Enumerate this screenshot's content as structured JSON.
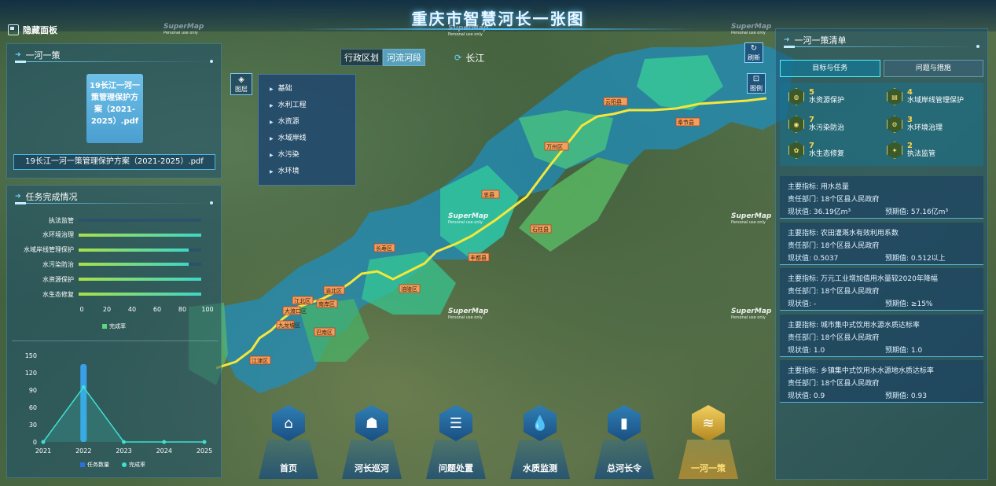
{
  "header": {
    "title": "重庆市智慧河长一张图",
    "hide_panel": "隐藏面板"
  },
  "watermark": {
    "brand": "SuperMap",
    "sub": "Personal use only"
  },
  "left_top": {
    "title": "一河一策",
    "doc_icon_text": "19长江一河一策管理保护方案（2021-2025）.pdf",
    "doc_name": "19长江一河一策管理保护方案（2021-2025）.pdf"
  },
  "task": {
    "title": "任务完成情况",
    "bars": [
      {
        "label": "执法监管",
        "value": 0
      },
      {
        "label": "水环境治理",
        "value": 100
      },
      {
        "label": "水域岸线管理保护",
        "value": 90
      },
      {
        "label": "水污染防治",
        "value": 90
      },
      {
        "label": "水资源保护",
        "value": 100
      },
      {
        "label": "水生态修复",
        "value": 100
      }
    ],
    "bar_ticks": [
      "0",
      "20",
      "40",
      "60",
      "80",
      "100"
    ],
    "bar_legend": "完成率",
    "line_chart": {
      "years": [
        "2021",
        "2022",
        "2023",
        "2024",
        "2025"
      ],
      "y_ticks": [
        "150",
        "120",
        "90",
        "60",
        "30",
        "0"
      ],
      "ymax": 150,
      "task_count": [
        0,
        135,
        0,
        0,
        0
      ],
      "completion": [
        0,
        95,
        0,
        0,
        0
      ],
      "legend_count": "任务数量",
      "legend_rate": "完成率"
    }
  },
  "map": {
    "tabs": [
      "行政区划",
      "河流河段"
    ],
    "river": "长江",
    "layer_btn": "图层",
    "layers": [
      "基础",
      "水利工程",
      "水资源",
      "水域岸线",
      "水污染",
      "水环境"
    ],
    "refresh": "刷新",
    "legend": "图例",
    "regions": [
      "云阳县",
      "奉节县",
      "万州区",
      "忠县",
      "石柱县",
      "长寿区",
      "丰都县",
      "涪陵区",
      "渝北区",
      "江北区",
      "南岸区",
      "巴南区",
      "江津区",
      "大渡口区",
      "九龙坡区"
    ]
  },
  "right": {
    "title": "一河一策清单",
    "tabs": [
      "目标与任务",
      "问题与措施"
    ],
    "goals": [
      {
        "num": "5",
        "name": "水资源保护",
        "icon": "shield-icon"
      },
      {
        "num": "4",
        "name": "水域岸线管理保护",
        "icon": "bank-icon"
      },
      {
        "num": "7",
        "name": "水污染防治",
        "icon": "drop-icon"
      },
      {
        "num": "3",
        "name": "水环境治理",
        "icon": "gear-icon"
      },
      {
        "num": "7",
        "name": "水生态修复",
        "icon": "leaf-icon"
      },
      {
        "num": "2",
        "name": "执法监管",
        "icon": "badge-icon"
      }
    ],
    "metrics": [
      {
        "label": "主要指标:",
        "indicator": "用水总量",
        "dept_label": "责任部门:",
        "dept": "18个区县人民政府",
        "cur_label": "现状值:",
        "cur": "36.19亿m³",
        "exp_label": "预期值:",
        "exp": "57.16亿m³"
      },
      {
        "label": "主要指标:",
        "indicator": "农田灌溉水有效利用系数",
        "dept_label": "责任部门:",
        "dept": "18个区县人民政府",
        "cur_label": "现状值:",
        "cur": "0.5037",
        "exp_label": "预期值:",
        "exp": "0.512以上"
      },
      {
        "label": "主要指标:",
        "indicator": "万元工业增加值用水量较2020年降幅",
        "dept_label": "责任部门:",
        "dept": "18个区县人民政府",
        "cur_label": "现状值:",
        "cur": "-",
        "exp_label": "预期值:",
        "exp": "≥15%"
      },
      {
        "label": "主要指标:",
        "indicator": "城市集中式饮用水源水质达标率",
        "dept_label": "责任部门:",
        "dept": "18个区县人民政府",
        "cur_label": "现状值:",
        "cur": "1.0",
        "exp_label": "预期值:",
        "exp": "1.0"
      },
      {
        "label": "主要指标:",
        "indicator": "乡镇集中式饮用水水源地水质达标率",
        "dept_label": "责任部门:",
        "dept": "18个区县人民政府",
        "cur_label": "现状值:",
        "cur": "0.9",
        "exp_label": "预期值:",
        "exp": "0.93"
      }
    ]
  },
  "nav": [
    {
      "label": "首页",
      "icon": "home-icon",
      "glyph": "⌂"
    },
    {
      "label": "河长巡河",
      "icon": "patrol-icon",
      "glyph": "☗"
    },
    {
      "label": "问题处置",
      "icon": "issue-icon",
      "glyph": "☰"
    },
    {
      "label": "水质监测",
      "icon": "water-drop-icon",
      "glyph": "💧"
    },
    {
      "label": "总河长令",
      "icon": "order-icon",
      "glyph": "▮"
    },
    {
      "label": "一河一策",
      "icon": "layers-icon",
      "glyph": "≋"
    }
  ]
}
